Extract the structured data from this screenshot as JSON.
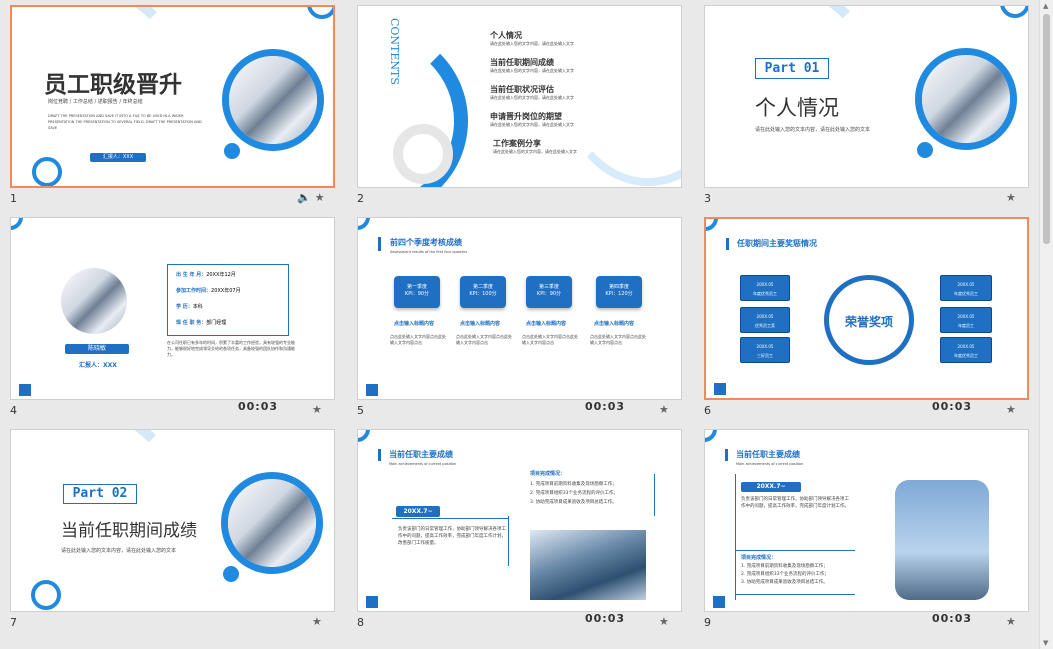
{
  "slides": [
    {
      "num": "1",
      "title": "员工职级晋升",
      "meta": "岗位竞聘  /  工作总结  /  述职报告  /  年终总结",
      "en": "DRAFT THE PRESENTATION AND SAVE IT INTO A FILE TO BE USED IN A WIDER PRESENTATION THE PRESENTATION TO SEVERAL FIELD. DRAFT THE PRESENTATION AND SAVE",
      "reporter": "汇报人：XXX",
      "timing": ""
    },
    {
      "num": "2",
      "vert": "CONTENTS",
      "items": [
        "个人情况",
        "当前任职期间成绩",
        "当前任职状况评估",
        "申请晋升岗位的期望",
        "工作案例分享"
      ],
      "sub": "请在此处输入您的文字内容，请在此处输入文字",
      "timing": ""
    },
    {
      "num": "3",
      "part": "Part 01",
      "title": "个人情况",
      "desc": "请在此处输入您的文本内容，请在此处输入您的文本",
      "timing": ""
    },
    {
      "num": "4",
      "name": "陈晓敏",
      "reporter": "汇报人：XXX",
      "rows": [
        {
          "k": "出 生 年 月：",
          "v": "20XX年12月"
        },
        {
          "k": "参加工作时间：",
          "v": "20XX年07月"
        },
        {
          "k": "学        历：",
          "v": "本科"
        },
        {
          "k": "现 任 职 务：",
          "v": "部门经理"
        }
      ],
      "para": "在公司任职已有多年的时间，积累了丰富的工作经验，具有较强的专业能力，能够很好地完成领导交给的各项任务，具备较强的团队协作和沟通能力。",
      "timing": "00:03"
    },
    {
      "num": "5",
      "title": "前四个季度考核成绩",
      "subtitle": "Assessment results of the first four quarters",
      "kpis": [
        {
          "q": "第一季度",
          "v": "KPI：90分"
        },
        {
          "q": "第二季度",
          "v": "KPI：100分"
        },
        {
          "q": "第三季度",
          "v": "KPI：90分"
        },
        {
          "q": "第四季度",
          "v": "KPI：120分"
        }
      ],
      "click": "点击输入标题内容",
      "desc": "点击此处输入文字内容点击此处输入文字内容点击",
      "timing": "00:03"
    },
    {
      "num": "6",
      "title": "任职期间主要奖惩情况",
      "center": "荣誉奖项",
      "left": [
        {
          "d": "20XX.05",
          "t": "年度优秀员工"
        },
        {
          "d": "20XX.05",
          "t": "优秀员工奖"
        },
        {
          "d": "20XX.05",
          "t": "三好员工"
        }
      ],
      "right": [
        {
          "d": "20XX.05",
          "t": "年度优秀员工"
        },
        {
          "d": "20XX.05",
          "t": "年度员工"
        },
        {
          "d": "20XX.05",
          "t": "年度优秀员工"
        }
      ],
      "timing": "00:03"
    },
    {
      "num": "7",
      "part": "Part 02",
      "title": "当前任职期间成绩",
      "desc": "请在此处输入您的文本内容，请在此处输入您的文本",
      "timing": ""
    },
    {
      "num": "8",
      "title": "当前任职主要成绩",
      "subtitle": "Main achievements of current position",
      "date": "20XX.7~",
      "body": "负责该部门的日常管理工作，协助部门领导解决各项工作中的问题，提高工作效率，完成部门年度工作计划，改善部门工作质量。",
      "list_title": "项目完成情况：",
      "list": [
        "1. 完成项目前期资料收集及现场勘察工作；",
        "2. 完成项目组织33个业务流程的评价工作；",
        "3. 协助完成项目成果验收及项目总结工作。"
      ],
      "timing": "00:03"
    },
    {
      "num": "9",
      "title": "当前任职主要成绩",
      "subtitle": "Main achievements of current position",
      "date": "20XX.7~",
      "body": "负责该部门的日常管理工作，协助部门领导解决各项工作中的问题，提高工作效率，完成部门年度计划工作。",
      "list_title": "项目完成情况：",
      "list": [
        "1. 完成项目前期资料收集及现场勘察工作；",
        "2. 完成项目组织33个业务流程的评价工作；",
        "3. 协助完成项目成果验收及项目总结工作。"
      ],
      "timing": "00:03"
    }
  ],
  "icons": {
    "sound": "speaker-icon",
    "star": "star-icon"
  },
  "colors": {
    "accent": "#1f6fc2",
    "selected": "#f08a5d"
  }
}
